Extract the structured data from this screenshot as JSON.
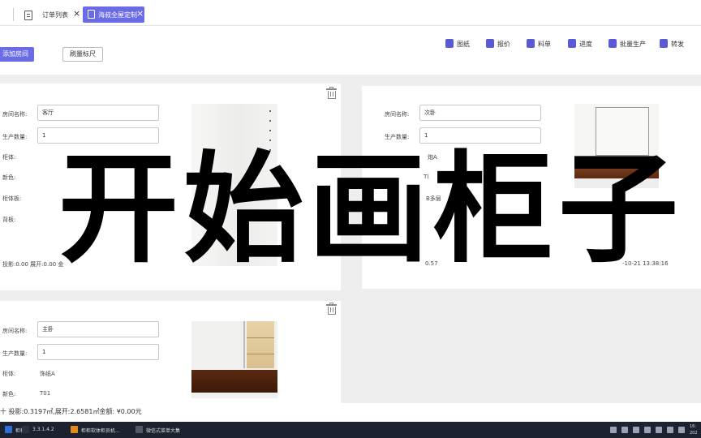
{
  "tabs": [
    {
      "label": "订单列表",
      "active": false
    },
    {
      "label": "海叔全屋定制",
      "active": true
    }
  ],
  "toolbar": {
    "add_room_label": "添加房间",
    "batch_scale_label": "刷量标尺",
    "actions": [
      {
        "label": "图纸",
        "icon": "drawing-icon"
      },
      {
        "label": "报价",
        "icon": "quote-icon"
      },
      {
        "label": "料单",
        "icon": "material-list-icon"
      },
      {
        "label": "进度",
        "icon": "progress-icon"
      },
      {
        "label": "批量生产",
        "icon": "batch-produce-icon"
      },
      {
        "label": "转发",
        "icon": "share-icon"
      }
    ]
  },
  "rooms": [
    {
      "name_label": "房间名称:",
      "name_value": "客厅",
      "qty_label": "生产数量:",
      "qty_value": "1",
      "cabinet_label": "柜体:",
      "door_label": "新色:",
      "board_label": "柜体板:",
      "back_label": "背板:",
      "footer": "投影:0.00   展开:0.00   金"
    },
    {
      "name_label": "房间名称:",
      "name_value": "次卧",
      "qty_label": "生产数量:",
      "qty_value": "1",
      "cabinet_value": "炮A",
      "door_value": "T(",
      "board_value": "B多层",
      "back_value": "",
      "footer": "0.57",
      "timestamp": "-10-21 13:38:16"
    },
    {
      "name_label": "房间名称:",
      "name_value": "主卧",
      "qty_label": "生产数量:",
      "qty_value": "1",
      "cabinet_label": "柜体:",
      "cabinet_value": "饰纸A",
      "door_label": "新色:",
      "door_value": "T01"
    }
  ],
  "overlay_caption": "开始画柜子",
  "summary": "十  投影:0.3197㎡,展开:2.6581㎡金额: ¥0.00元",
  "taskbar": {
    "items": [
      {
        "label": "柜柜",
        "color": "#2f6fd6"
      },
      {
        "label": "3.3.1.4.2",
        "color": "#2a3140"
      },
      {
        "label": "柜柜软体柜员机...",
        "color": "#e08a1e"
      },
      {
        "label": "微信式菜单大集",
        "color": "#555a66"
      }
    ],
    "clock": "16:\n202"
  }
}
